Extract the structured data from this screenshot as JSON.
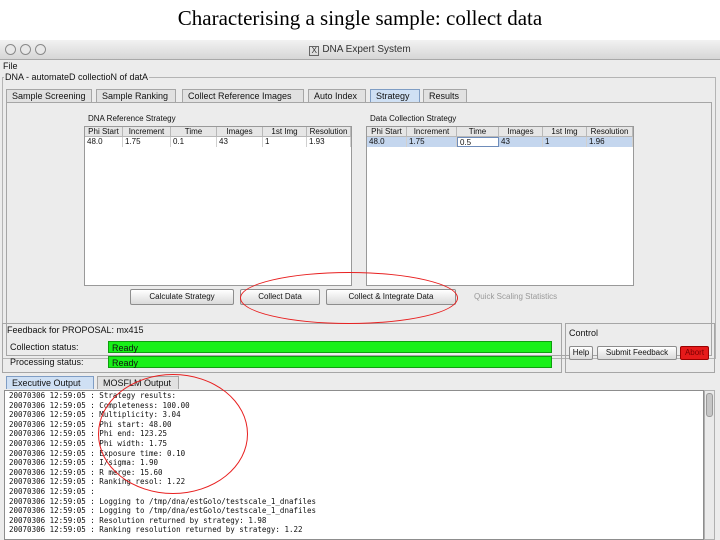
{
  "slide": {
    "title": "Characterising a single sample: collect data"
  },
  "window": {
    "title": "DNA Expert System",
    "x_icon": "x-window-icon"
  },
  "menu": {
    "file": "File"
  },
  "group": {
    "label": "DNA - automateD collectioN of datA"
  },
  "tabs": [
    {
      "label": "Sample Screening"
    },
    {
      "label": "Sample Ranking"
    },
    {
      "label": "Collect Reference Images"
    },
    {
      "label": "Auto Index"
    },
    {
      "label": "Strategy"
    },
    {
      "label": "Results"
    }
  ],
  "reference_strategy": {
    "title": "DNA Reference Strategy",
    "columns": [
      "Phi Start",
      "Increment",
      "Time",
      "Images",
      "1st Img",
      "Resolution"
    ],
    "row": [
      "48.0",
      "1.75",
      "0.1",
      "43",
      "1",
      "1.93"
    ]
  },
  "collection_strategy": {
    "title": "Data Collection Strategy",
    "columns": [
      "Phi Start",
      "Increment",
      "Time",
      "Images",
      "1st Img",
      "Resolution"
    ],
    "row": [
      "48.0",
      "1.75",
      "0.5",
      "43",
      "1",
      "1.96"
    ]
  },
  "buttons": {
    "calculate": "Calculate Strategy",
    "collect": "Collect Data",
    "collect_integrate": "Collect & Integrate Data",
    "quick_scaling": "Quick Scaling Statistics"
  },
  "feedback": {
    "title": "Feedback for PROPOSAL: mx415",
    "collection_label": "Collection status:",
    "collection_value": "Ready",
    "processing_label": "Processing status:",
    "processing_value": "Ready"
  },
  "control": {
    "title": "Control",
    "help": "Help",
    "submit": "Submit Feedback",
    "abort": "Abort"
  },
  "output_tabs": [
    {
      "label": "Executive Output"
    },
    {
      "label": "MOSFLM Output"
    }
  ],
  "log_lines": [
    "20070306 12:59:05 : Strategy results:",
    "20070306 12:59:05 :   Completeness:     100.00",
    "20070306 12:59:05 :   Multiplicity:       3.04",
    "20070306 12:59:05 :   Phi start:         48.00",
    "20070306 12:59:05 :   Phi end:          123.25",
    "20070306 12:59:05 :   Phi width:          1.75",
    "20070306 12:59:05 :   Exposure time:      0.10",
    "20070306 12:59:05 :   I/sigma:            1.90",
    "20070306 12:59:05 :   R merge:           15.60",
    "20070306 12:59:05 :   Ranking resol:      1.22",
    "20070306 12:59:05 : ",
    "20070306 12:59:05 : Logging to /tmp/dna/estGolo/testscale_1_dnafiles",
    "20070306 12:59:05 : Logging to /tmp/dna/estGolo/testscale_1_dnafiles",
    "20070306 12:59:05 : Resolution returned by strategy: 1.98",
    "20070306 12:59:05 : Ranking resolution returned by strategy: 1.22"
  ],
  "colors": {
    "annotation": "#e82020",
    "status_ready": "#18f018",
    "abort": "#e61a1a",
    "selected_tab": "#cfe0f4"
  }
}
